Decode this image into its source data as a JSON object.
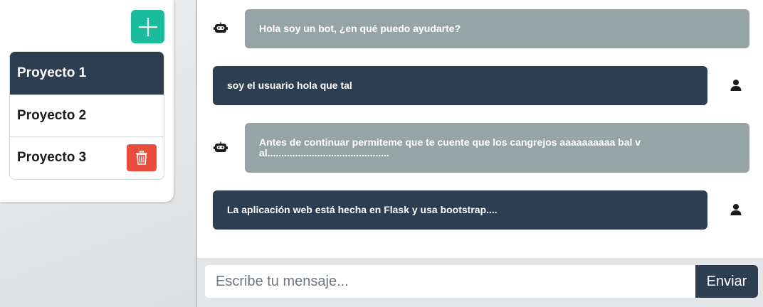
{
  "sidebar": {
    "add_icon": "plus-icon",
    "projects": [
      {
        "label": "Proyecto 1"
      },
      {
        "label": "Proyecto 2"
      },
      {
        "label": "Proyecto 3"
      }
    ],
    "delete_icon": "trash-icon"
  },
  "chat": {
    "messages": [
      {
        "sender": "bot",
        "icon": "robot-icon",
        "text": "Hola soy un bot, ¿en qué puedo ayudarte?"
      },
      {
        "sender": "user",
        "icon": "user-icon",
        "text": "soy el usuario hola que tal"
      },
      {
        "sender": "bot",
        "icon": "robot-icon",
        "text": "Antes de continuar permiteme que te cuente que los cangrejos aaaaaaaaaa bal val............................................"
      },
      {
        "sender": "user",
        "icon": "user-icon",
        "text": "La aplicación web está hecha en Flask y usa bootstrap...."
      }
    ]
  },
  "input": {
    "placeholder": "Escribe tu mensaje...",
    "send_label": "Enviar"
  },
  "colors": {
    "accent_green": "#1abc9c",
    "dark": "#2c3e50",
    "bot_bubble": "#95a5a6",
    "danger": "#e74c3c"
  }
}
